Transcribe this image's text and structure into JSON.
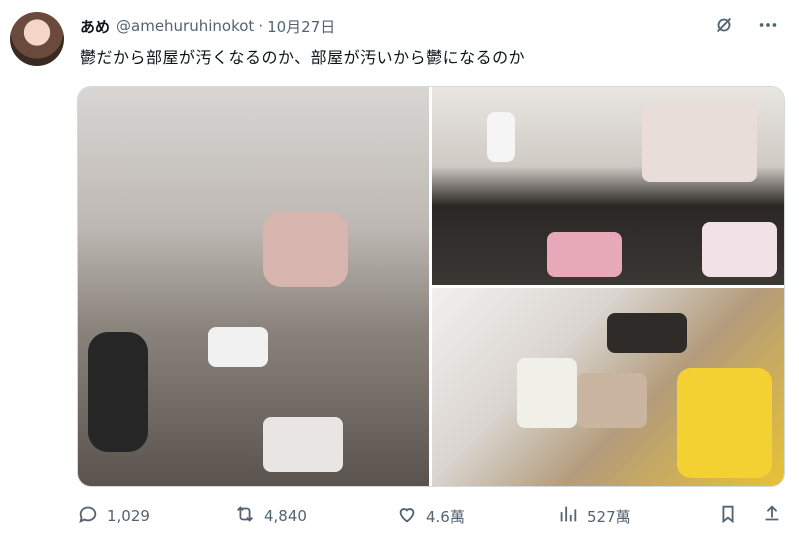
{
  "author": {
    "display_name": "あめ",
    "handle": "@amehuruhinokot",
    "separator": "·",
    "date": "10月27日"
  },
  "tweet": {
    "text": "鬱だから部屋が汚くなるのか、部屋が汚いから鬱になるのか"
  },
  "header_icons": [
    "grok-icon",
    "more-options-icon"
  ],
  "media": {
    "count": 3
  },
  "actions": {
    "replies": "1,029",
    "retweets": "4,840",
    "likes": "4.6萬",
    "views": "527萬"
  },
  "colors": {
    "secondary_text": "#536471",
    "border": "#cfd9de"
  }
}
